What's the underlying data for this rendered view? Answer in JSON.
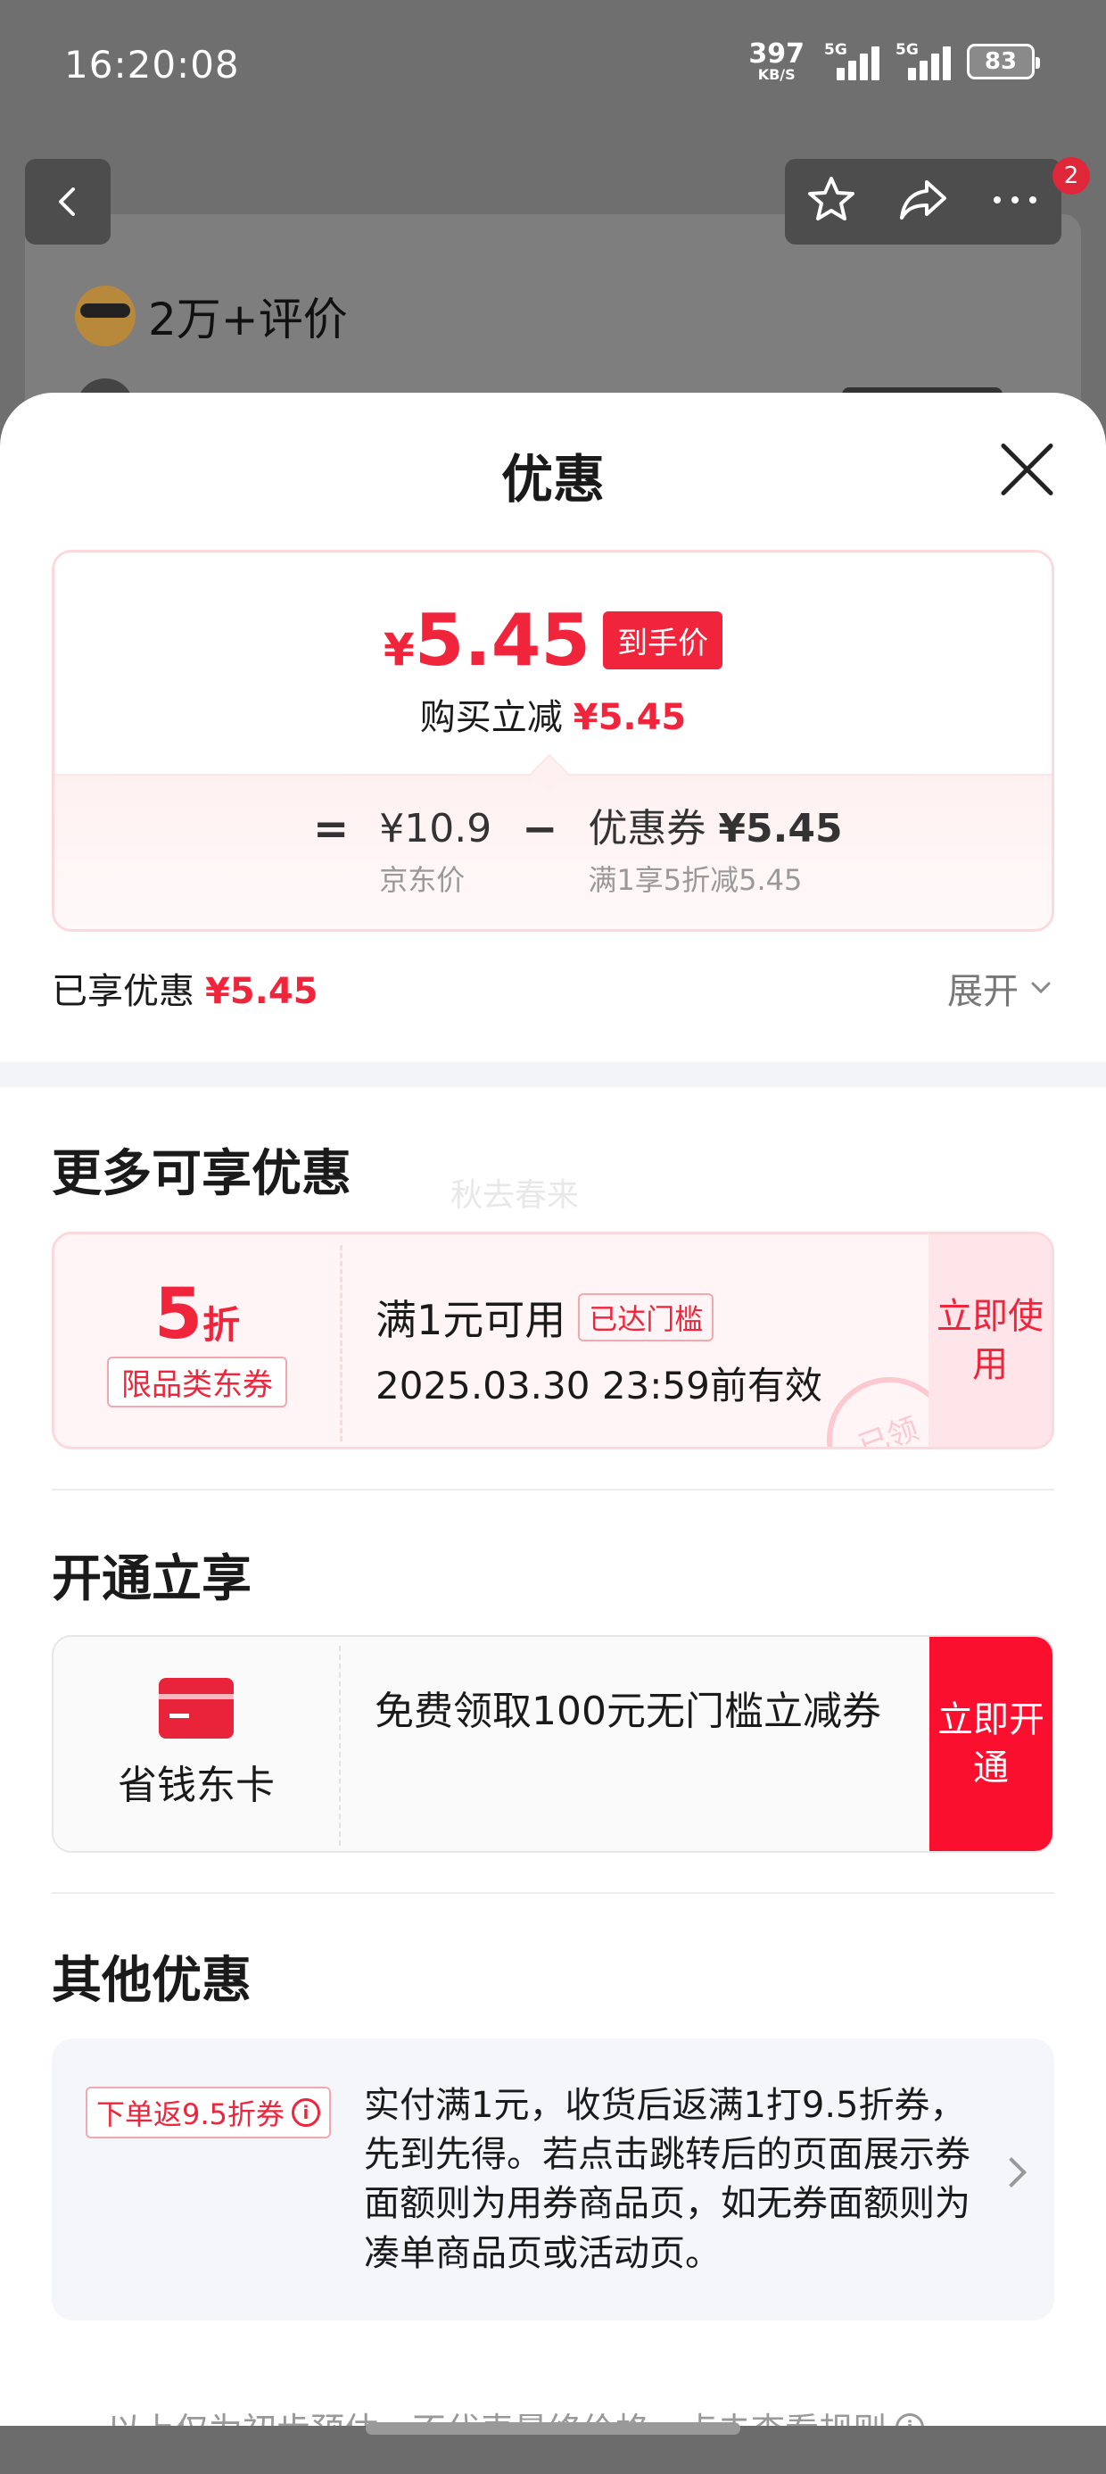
{
  "status_bar": {
    "time": "16:20:08",
    "net_speed": "397",
    "net_unit": "KB/S",
    "sim1": "5G",
    "sim2": "5G",
    "battery": "83"
  },
  "background_page": {
    "review_count": "2万+评价",
    "cart_badge": "2",
    "icons": [
      "back-icon",
      "star-icon",
      "share-icon",
      "more-icon"
    ]
  },
  "sheet": {
    "title": "优惠",
    "price_summary": {
      "final_currency": "¥",
      "final_amount": "5.45",
      "final_tag": "到手价",
      "buy_reduce_label": "购买立减",
      "buy_reduce_value": "¥5.45",
      "equals": "=",
      "jd_price": "¥10.9",
      "jd_price_label": "京东价",
      "minus": "−",
      "coupon_label": "优惠券",
      "coupon_value": "¥5.45",
      "coupon_rule": "满1享5折减5.45"
    },
    "enjoyed_label": "已享优惠",
    "enjoyed_value": "¥5.45",
    "expand_label": "展开"
  },
  "more_offers": {
    "title": "更多可享优惠",
    "watermark": "秋去春来",
    "coupon": {
      "discount_number": "5",
      "discount_unit": "折",
      "category": "限品类东券",
      "condition": "满1元可用",
      "status_tag": "已达门槛",
      "validity": "2025.03.30 23:59前有效",
      "stamp": "已领",
      "use_button": "立即使用"
    }
  },
  "membership": {
    "title": "开通立享",
    "card_name": "省钱东卡",
    "description": "免费领取100元无门槛立减券",
    "open_button": "立即开通"
  },
  "other_offers": {
    "title": "其他优惠",
    "tag": "下单返9.5折券",
    "description": "实付满1元，收货后返满1打9.5折券，先到先得。若点击跳转后的页面展示券面额则为用券商品页，如无券面额则为凑单商品页或活动页。"
  },
  "footnote": "以上仅为初步预估，不代表最终价格，点击查看规则",
  "colors": {
    "accent_red": "#f0243a",
    "button_red": "#fb0f2e",
    "coupon_pink_bg": "#fff5f6",
    "muted_gray": "#999999"
  }
}
